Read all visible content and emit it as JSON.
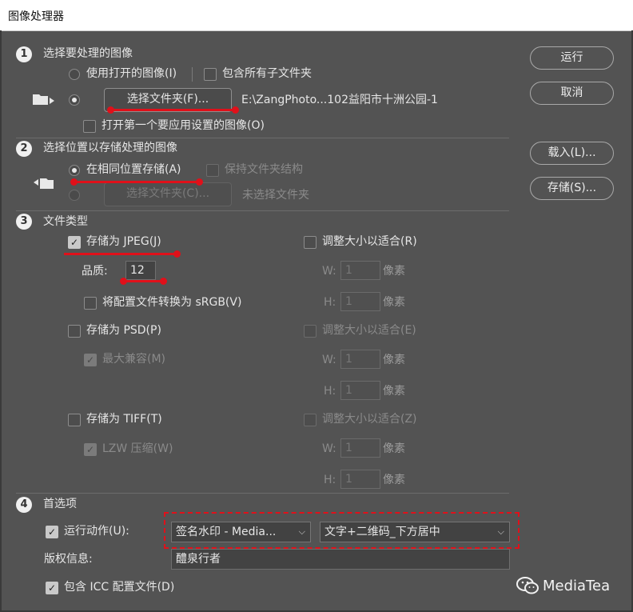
{
  "title": "图像处理器",
  "s1": {
    "num": "1",
    "heading": "选择要处理的图像",
    "use_open": "使用打开的图像(I)",
    "include_sub": "包含所有子文件夹",
    "select_folder": "选择文件夹(F)...",
    "path": "E:\\ZangPhoto...102益阳市十洲公园-1",
    "open_first": "打开第一个要应用设置的图像(O)"
  },
  "s2": {
    "num": "2",
    "heading": "选择位置以存储处理的图像",
    "same_loc": "在相同位置存储(A)",
    "keep_struct": "保持文件夹结构",
    "select_folder": "选择文件夹(C)...",
    "no_folder": "未选择文件夹"
  },
  "s3": {
    "num": "3",
    "heading": "文件类型",
    "jpeg": "存储为 JPEG(J)",
    "resize_r": "调整大小以适合(R)",
    "quality_label": "品质:",
    "quality_value": "12",
    "w": "W:",
    "h": "H:",
    "one": "1",
    "px": "像素",
    "srgb": "将配置文件转换为 sRGB(V)",
    "psd": "存储为 PSD(P)",
    "resize_e": "调整大小以适合(E)",
    "max_compat": "最大兼容(M)",
    "tiff": "存储为 TIFF(T)",
    "resize_z": "调整大小以适合(Z)",
    "lzw": "LZW 压缩(W)"
  },
  "s4": {
    "num": "4",
    "heading": "首选项",
    "run_action": "运行动作(U):",
    "action_set": "签名水印 - Media...",
    "action_name": "文字+二维码_下方居中",
    "copyright_label": "版权信息:",
    "copyright_value": "醴泉行者",
    "icc": "包含 ICC 配置文件(D)"
  },
  "buttons": {
    "run": "运行",
    "cancel": "取消",
    "load": "载入(L)...",
    "save": "存储(S)..."
  },
  "watermark": "MediaTea",
  "colors": {
    "annotation_red": "#e0101a",
    "dialog_bg": "#535353"
  }
}
